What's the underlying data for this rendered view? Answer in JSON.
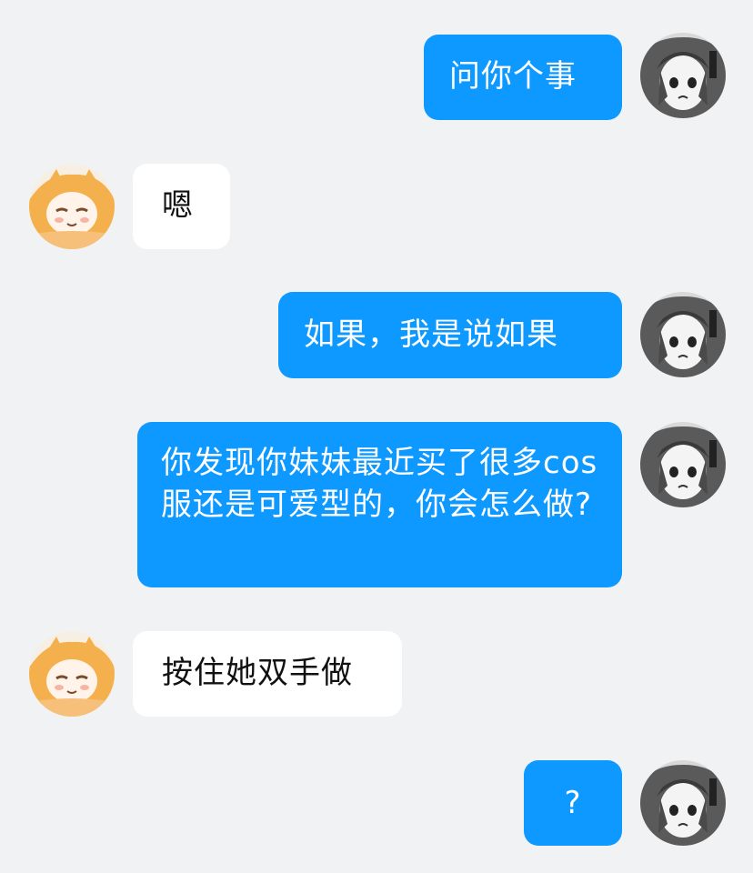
{
  "conversation": {
    "messages": [
      {
        "sender": "me",
        "text": "问你个事"
      },
      {
        "sender": "friend",
        "text": "嗯"
      },
      {
        "sender": "me",
        "text": "如果，我是说如果"
      },
      {
        "sender": "me",
        "text": "你发现你妹妹最近买了很多cos服还是可爱型的，你会怎么做?"
      },
      {
        "sender": "friend",
        "text": "按住她双手做"
      },
      {
        "sender": "me",
        "text": "?"
      }
    ]
  },
  "colors": {
    "background": "#f1f2f4",
    "outgoing_bubble": "#0d99ff",
    "incoming_bubble": "#ffffff"
  },
  "icons": {
    "me_avatar": "grayscale-anime-girl-avatar",
    "friend_avatar": "orange-hair-anime-avatar"
  }
}
